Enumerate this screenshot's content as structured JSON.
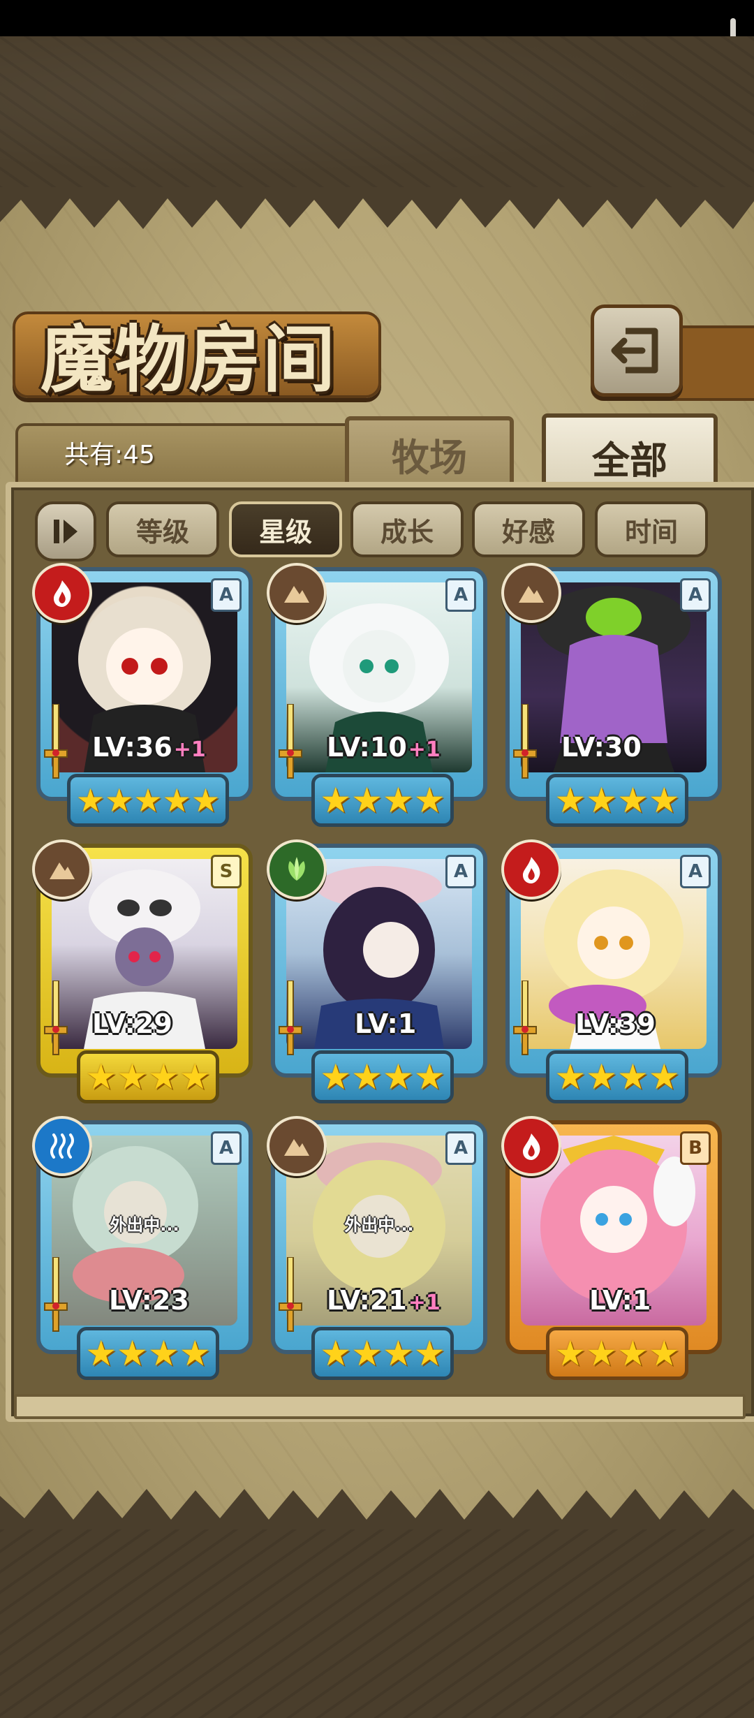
{
  "title": "魔物房间",
  "count_label": "共有:45",
  "tabs": [
    {
      "label": "牧场",
      "active": false
    },
    {
      "label": "全部",
      "active": true
    }
  ],
  "sort_buttons": [
    {
      "label": "等级",
      "active": false
    },
    {
      "label": "星级",
      "active": true
    },
    {
      "label": "成长",
      "active": false
    },
    {
      "label": "好感",
      "active": false
    },
    {
      "label": "时间",
      "active": false
    }
  ],
  "sort_toggle_icon": "sort-order-icon",
  "back_icon": "back-arrow-icon",
  "colors": {
    "fire": "#c41c1c",
    "earth": "#6a4a30",
    "nature": "#2d6a28",
    "water": "#1c78c8",
    "active_sort_bg": "#3d3121",
    "stars": "#ffd21a"
  },
  "monsters": [
    {
      "element": "fire",
      "rank": "A",
      "level": "LV:36",
      "bonus": "+1",
      "stars": 5,
      "frame": "blue",
      "status": ""
    },
    {
      "element": "earth",
      "rank": "A",
      "level": "LV:10",
      "bonus": "+1",
      "stars": 4,
      "frame": "blue",
      "status": ""
    },
    {
      "element": "earth",
      "rank": "A",
      "level": "LV:30",
      "bonus": "",
      "stars": 4,
      "frame": "blue",
      "status": ""
    },
    {
      "element": "earth",
      "rank": "S",
      "level": "LV:29",
      "bonus": "",
      "stars": 4,
      "frame": "gold",
      "status": ""
    },
    {
      "element": "nature",
      "rank": "A",
      "level": "LV:1",
      "bonus": "",
      "stars": 4,
      "frame": "blue",
      "status": ""
    },
    {
      "element": "fire",
      "rank": "A",
      "level": "LV:39",
      "bonus": "",
      "stars": 4,
      "frame": "blue",
      "status": ""
    },
    {
      "element": "water",
      "rank": "A",
      "level": "LV:23",
      "bonus": "",
      "stars": 4,
      "frame": "blue",
      "status": "外出中..."
    },
    {
      "element": "earth",
      "rank": "A",
      "level": "LV:21",
      "bonus": "+1",
      "stars": 4,
      "frame": "blue",
      "status": "外出中..."
    },
    {
      "element": "fire",
      "rank": "B",
      "level": "LV:1",
      "bonus": "",
      "stars": 4,
      "frame": "orange",
      "status": ""
    }
  ]
}
